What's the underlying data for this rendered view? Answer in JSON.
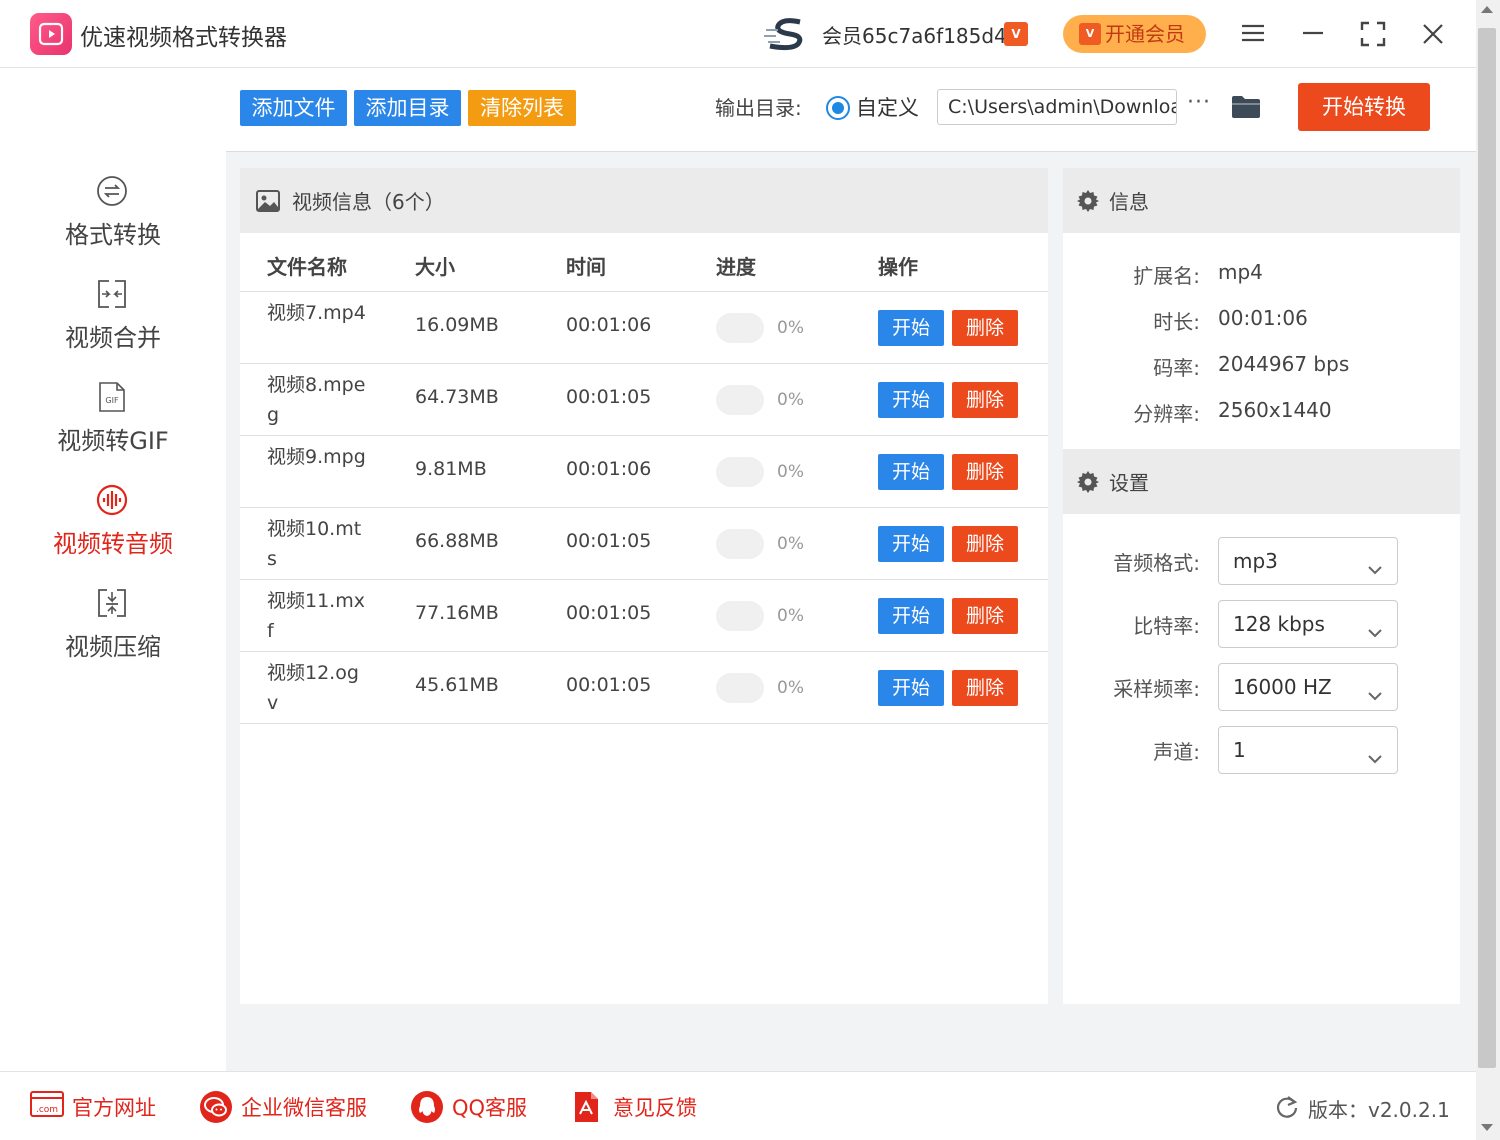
{
  "app": {
    "title": "优速视频格式转换器"
  },
  "header": {
    "user_icon": "brand-s-icon",
    "user_name": "会员65c7a6f185d4",
    "vip_badge": "V",
    "vip_button": "开通会员",
    "controls": [
      "menu-icon",
      "minimize-icon",
      "fullscreen-icon",
      "close-icon"
    ]
  },
  "sidebar": {
    "items": [
      {
        "label": "格式转换",
        "icon": "convert-icon",
        "active": false
      },
      {
        "label": "视频合并",
        "icon": "merge-icon",
        "active": false
      },
      {
        "label": "视频转GIF",
        "icon": "gif-icon",
        "active": false
      },
      {
        "label": "视频转音频",
        "icon": "audio-wave-icon",
        "active": true
      },
      {
        "label": "视频压缩",
        "icon": "compress-icon",
        "active": false
      }
    ]
  },
  "toolbar": {
    "add_file": "添加文件",
    "add_folder": "添加目录",
    "clear_list": "清除列表",
    "output_label": "输出目录:",
    "custom_option": "自定义",
    "output_path": "C:\\Users\\admin\\Downloads",
    "more": "···",
    "start_all": "开始转换"
  },
  "file_list": {
    "title": "视频信息（6个）",
    "columns": [
      "文件名称",
      "大小",
      "时间",
      "进度",
      "操作"
    ],
    "rows": [
      {
        "name": "视频7.mp4",
        "size": "16.09MB",
        "time": "00:01:06",
        "progress": "0%",
        "progress_value": 0
      },
      {
        "name": "视频8.mpeg",
        "size": "64.73MB",
        "time": "00:01:05",
        "progress": "0%",
        "progress_value": 0
      },
      {
        "name": "视频9.mpg",
        "size": "9.81MB",
        "time": "00:01:06",
        "progress": "0%",
        "progress_value": 0
      },
      {
        "name": "视频10.mts",
        "size": "66.88MB",
        "time": "00:01:05",
        "progress": "0%",
        "progress_value": 0
      },
      {
        "name": "视频11.mxf",
        "size": "77.16MB",
        "time": "00:01:05",
        "progress": "0%",
        "progress_value": 0
      },
      {
        "name": "视频12.ogv",
        "size": "45.61MB",
        "time": "00:01:05",
        "progress": "0%",
        "progress_value": 0
      }
    ],
    "start_label": "开始",
    "delete_label": "删除"
  },
  "info": {
    "title": "信息",
    "fields": [
      {
        "label": "扩展名:",
        "value": "mp4"
      },
      {
        "label": "时长:",
        "value": "00:01:06"
      },
      {
        "label": "码率:",
        "value": "2044967 bps"
      },
      {
        "label": "分辨率:",
        "value": "2560x1440"
      }
    ]
  },
  "settings": {
    "title": "设置",
    "fields": [
      {
        "label": "音频格式:",
        "value": "mp3"
      },
      {
        "label": "比特率:",
        "value": "128 kbps"
      },
      {
        "label": "采样频率:",
        "value": "16000 HZ"
      },
      {
        "label": "声道:",
        "value": "1"
      }
    ]
  },
  "footer": {
    "links": [
      {
        "label": "官方网址",
        "icon": "web-icon"
      },
      {
        "label": "企业微信客服",
        "icon": "wechat-icon"
      },
      {
        "label": "QQ客服",
        "icon": "qq-icon"
      },
      {
        "label": "意见反馈",
        "icon": "feedback-icon"
      }
    ],
    "version": "版本：v2.0.2.1"
  },
  "colors": {
    "accent_blue": "#2a86e8",
    "accent_red": "#ec4a1c",
    "accent_orange": "#f39c12",
    "active_nav": "#e1251b"
  }
}
